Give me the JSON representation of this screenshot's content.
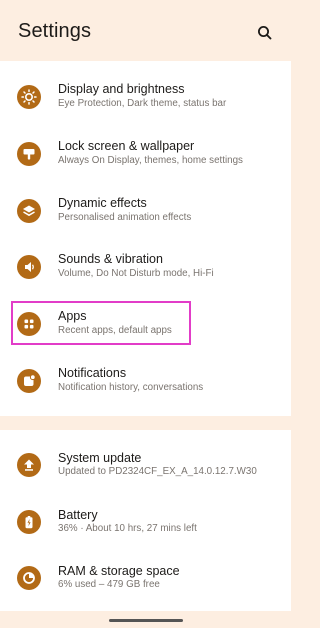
{
  "header": {
    "title": "Settings"
  },
  "colors": {
    "accent": "#b26a16",
    "highlight": "#e23cc8",
    "background": "#fdeee1"
  },
  "group1": [
    {
      "label": "Display and brightness",
      "sub": "Eye Protection, Dark theme, status bar",
      "icon": "brightness-icon"
    },
    {
      "label": "Lock screen & wallpaper",
      "sub": "Always On Display, themes, home settings",
      "icon": "wallpaper-icon"
    },
    {
      "label": "Dynamic effects",
      "sub": "Personalised animation effects",
      "icon": "layers-icon"
    },
    {
      "label": "Sounds & vibration",
      "sub": "Volume, Do Not Disturb mode, Hi-Fi",
      "icon": "speaker-icon"
    },
    {
      "label": "Apps",
      "sub": "Recent apps, default apps",
      "icon": "apps-grid-icon"
    },
    {
      "label": "Notifications",
      "sub": "Notification history, conversations",
      "icon": "notification-icon"
    }
  ],
  "group2": [
    {
      "label": "System update",
      "sub": "Updated to PD2324CF_EX_A_14.0.12.7.W30",
      "icon": "update-icon"
    },
    {
      "label": "Battery",
      "sub": "36% · About 10 hrs, 27 mins left",
      "icon": "battery-icon"
    },
    {
      "label": "RAM & storage space",
      "sub": "6% used – 479 GB free",
      "icon": "storage-icon"
    }
  ]
}
